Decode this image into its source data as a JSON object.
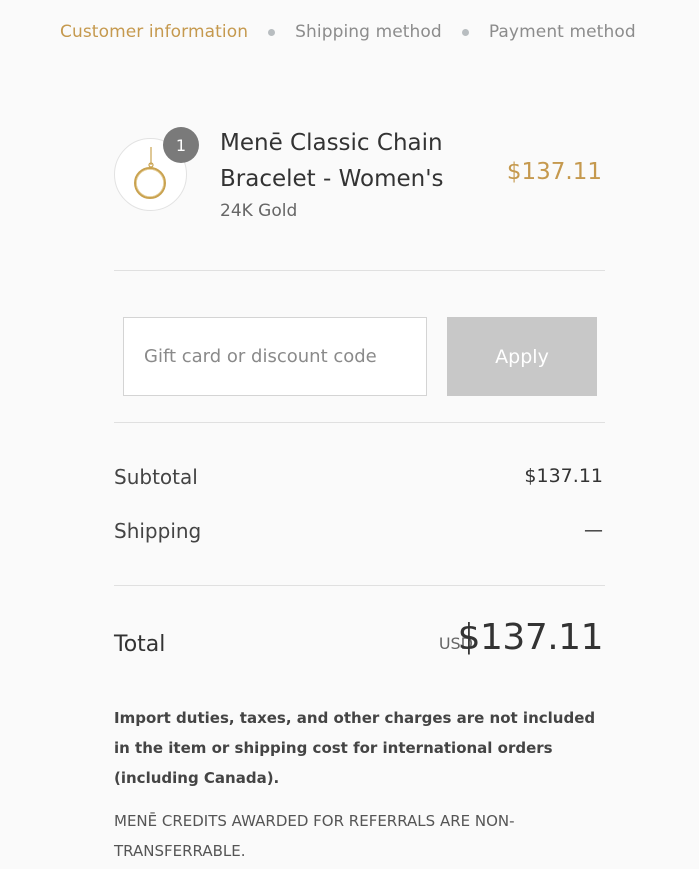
{
  "breadcrumb": {
    "steps": [
      {
        "label": "Customer information"
      },
      {
        "label": "Shipping method"
      },
      {
        "label": "Payment method"
      }
    ],
    "active_index": 0
  },
  "product": {
    "quantity": "1",
    "name": "Menē Classic Chain Bracelet - Women's",
    "variant": "24K Gold",
    "price": "$137.11",
    "image_icon": "bracelet-icon"
  },
  "discount": {
    "placeholder": "Gift card or discount code",
    "value": "",
    "apply_label": "Apply"
  },
  "totals": {
    "subtotal_label": "Subtotal",
    "subtotal_value": "$137.11",
    "shipping_label": "Shipping",
    "shipping_value": "—",
    "total_label": "Total",
    "currency": "USD",
    "total_value": "$137.11"
  },
  "notices": {
    "duties": "Import duties, taxes, and other charges are not included in the item or shipping cost for international orders (including Canada).",
    "credits": "MENĒ CREDITS AWARDED FOR REFERRALS ARE NON-TRANSFERRABLE."
  },
  "colors": {
    "accent": "#c5994e",
    "button_disabled": "#c8c8c8",
    "background": "#fafafa"
  }
}
